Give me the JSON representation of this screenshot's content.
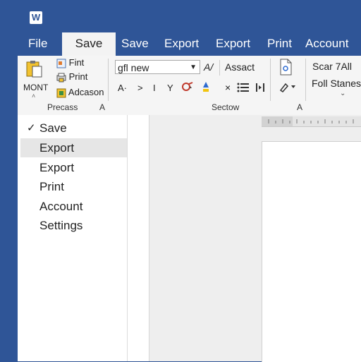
{
  "tabs": [
    {
      "label": "File"
    },
    {
      "label": "Save",
      "active": true
    },
    {
      "label": "Save"
    },
    {
      "label": "Export"
    },
    {
      "label": "Export"
    },
    {
      "label": "Print"
    },
    {
      "label": "Account"
    }
  ],
  "ribbon": {
    "group1": {
      "big_button_label": "MONT",
      "items": [
        {
          "label": "Fint"
        },
        {
          "label": "Print"
        },
        {
          "label": "Adcason"
        }
      ],
      "group_label": "Precass",
      "corner": "A"
    },
    "group2": {
      "font_name": "gfl new",
      "font_style_label": "A/",
      "assist_label": "Assact",
      "row2": {
        "a": "A·",
        "b": ">",
        "c": "I",
        "d": "Y",
        "h": "×"
      },
      "group_label": "Sectow",
      "corner": "A"
    },
    "group3": {
      "scan_label": "Scar 7All",
      "styles_label": "Foll Stanes"
    }
  },
  "backstage": {
    "items": [
      {
        "label": "Save",
        "checked": true
      },
      {
        "label": "Export",
        "selected": true
      },
      {
        "label": "Export"
      },
      {
        "label": "Print"
      },
      {
        "label": "Account"
      },
      {
        "label": "Settings"
      }
    ]
  },
  "colors": {
    "brand": "#2f5597",
    "ribbon_bg": "#f5f5f5",
    "selected_bg": "#e6e6e6"
  },
  "icons": [
    "word-logo-icon",
    "clipboard-icon",
    "fint-icon",
    "print-icon",
    "adcason-icon",
    "dropdown-arrow-icon",
    "font-color-icon",
    "highlight-icon",
    "bullet-list-icon",
    "indent-icon",
    "document-icon",
    "brush-icon",
    "chevron-down-icon",
    "check-icon"
  ]
}
